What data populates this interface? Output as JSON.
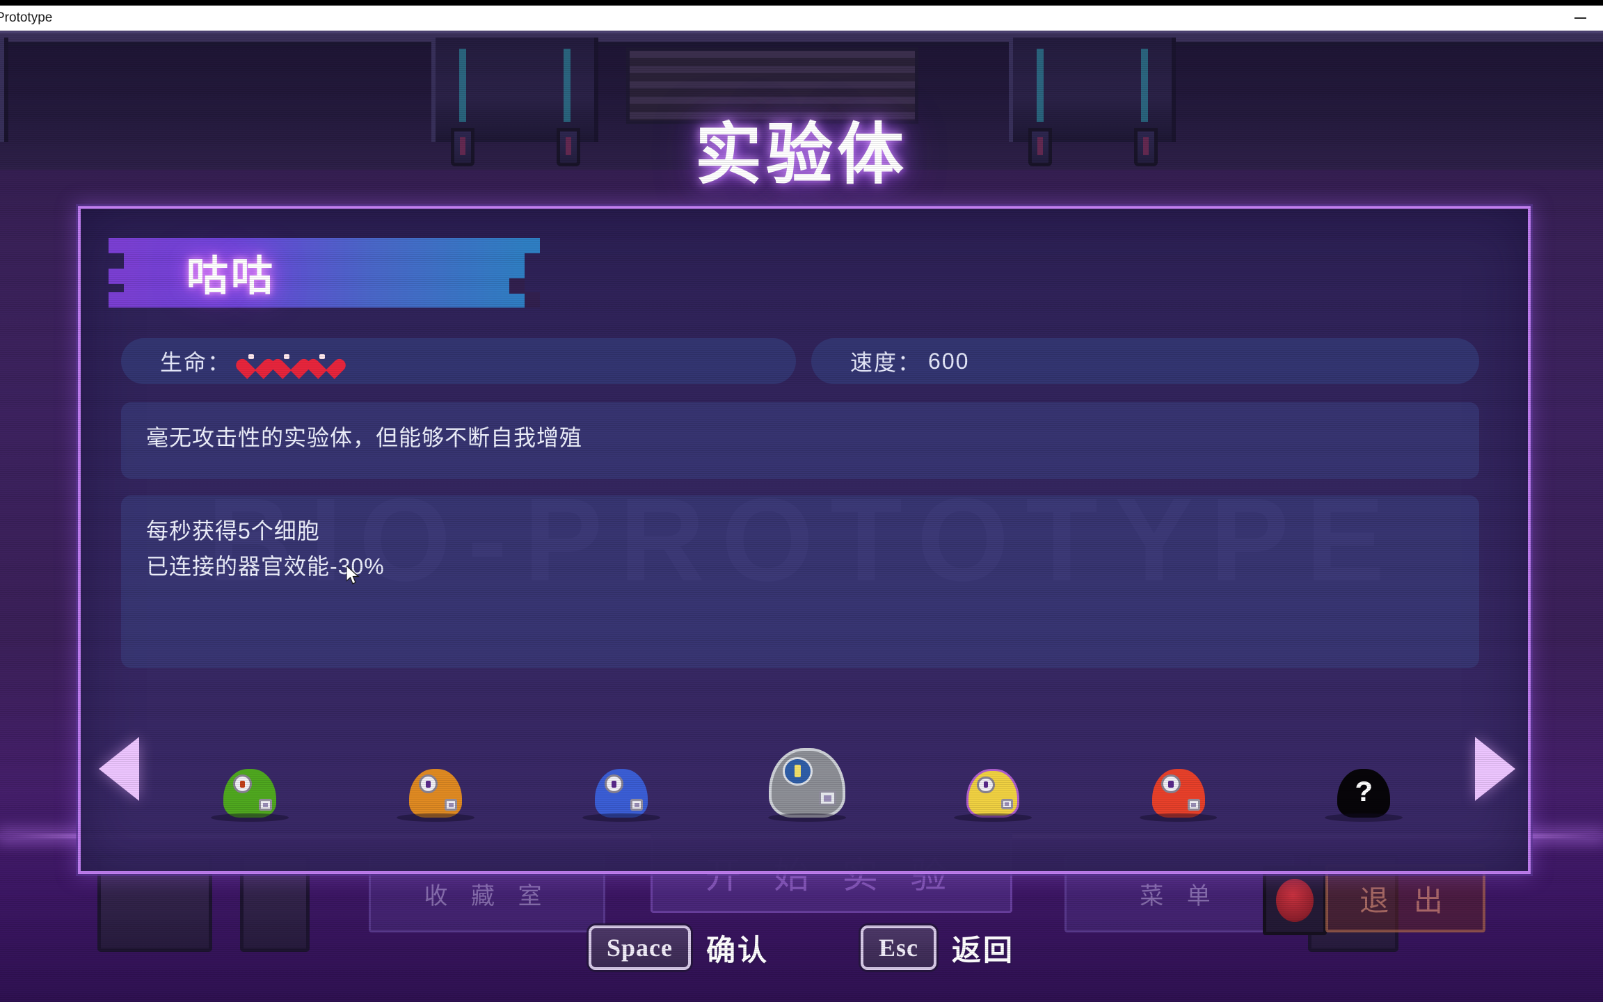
{
  "window": {
    "title": "Prototype",
    "minimize_icon": "minimize-icon"
  },
  "game": {
    "page_title": "实验体",
    "panel_watermark": "BIO-PROTOTYPE"
  },
  "subject": {
    "name": "咕咕",
    "stats": [
      {
        "key": "hp",
        "label": "生命：",
        "type": "hearts",
        "hearts": 3
      },
      {
        "key": "speed",
        "label": "速度：",
        "type": "value",
        "value": "600"
      }
    ],
    "description": "毫无攻击性的实验体，但能够不断自我增殖",
    "abilities": [
      "每秒获得5个细胞",
      "已连接的器官效能-30%"
    ]
  },
  "carousel": {
    "prev_arrow_icon": "chevron-left-icon",
    "next_arrow_icon": "chevron-right-icon",
    "slots": [
      {
        "id": "green",
        "color": "#4fa81f",
        "eye": "#c4401a",
        "locked": false,
        "selected": false
      },
      {
        "id": "orange",
        "color": "#e08a22",
        "eye": "#5a2a8c",
        "locked": false,
        "selected": false
      },
      {
        "id": "blue",
        "color": "#3b5ed6",
        "eye": "#5a2a8c",
        "locked": false,
        "selected": false
      },
      {
        "id": "grey",
        "color": "#8d8f96",
        "eye": "#2f5ea8",
        "locked": false,
        "selected": true
      },
      {
        "id": "yellow",
        "color": "#f0d142",
        "eye": "#5a2a8c",
        "locked": false,
        "selected": false
      },
      {
        "id": "red",
        "color": "#e8402a",
        "eye": "#5a2a8c",
        "locked": false,
        "selected": false
      },
      {
        "id": "locked",
        "color": "#070509",
        "eye": "#000000",
        "locked": true,
        "selected": false,
        "placeholder": "?"
      }
    ]
  },
  "key_prompts": [
    {
      "key": "Space",
      "label": "确认"
    },
    {
      "key": "Esc",
      "label": "返回"
    }
  ],
  "background_menu": {
    "collection": "收 藏 室",
    "start": "开 始 实 验",
    "menu": "菜 单",
    "exit": "退 出"
  },
  "colors": {
    "panel_border": "#c07ef0",
    "accent_glow": "#d694ff",
    "banner_start": "#7b3fd4",
    "banner_end": "#2f7fc4",
    "heart": "#e8253c",
    "arrow": "#edc5ff"
  }
}
